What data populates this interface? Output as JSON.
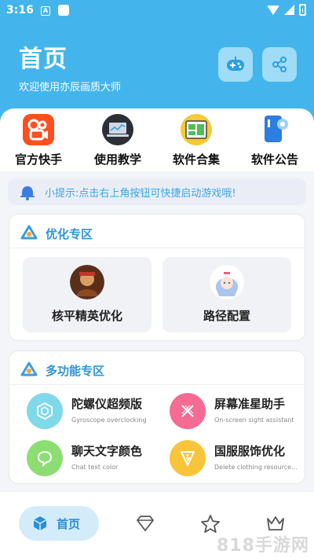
{
  "status_bar": {
    "time": "3:16",
    "notif_icon": "A"
  },
  "header": {
    "title": "首页",
    "subtitle": "欢迎使用亦辰画质大师",
    "buttons": [
      {
        "icon": "gamepad-icon"
      },
      {
        "icon": "share-icon"
      }
    ]
  },
  "quick_nav": [
    {
      "label": "官方快手",
      "icon": "kuaishou-logo-icon"
    },
    {
      "label": "使用教学",
      "icon": "laptop-icon"
    },
    {
      "label": "软件合集",
      "icon": "app-collection-icon"
    },
    {
      "label": "软件公告",
      "icon": "announcement-icon"
    }
  ],
  "tip": {
    "text": "小提示:点击右上角按钮可快捷启动游戏哦!",
    "icon": "bell-icon"
  },
  "optimize_section": {
    "title": "优化专区",
    "items": [
      {
        "label": "核平精英优化",
        "icon": "game-character-avatar"
      },
      {
        "label": "路径配置",
        "icon": "anime-girl-avatar"
      }
    ]
  },
  "multi_section": {
    "title": "多功能专区",
    "items": [
      {
        "title": "陀螺仪超频版",
        "subtitle": "Gyroscope overclocking",
        "color": "#7fd9e8",
        "icon": "hexagon-icon"
      },
      {
        "title": "屏幕准星助手",
        "subtitle": "On-screen sight assistant",
        "color": "#f56b93",
        "icon": "crosshair-x-icon"
      },
      {
        "title": "聊天文字颜色",
        "subtitle": "Chat text color",
        "color": "#8cde73",
        "icon": "chat-bubble-icon"
      },
      {
        "title": "国服服饰优化",
        "subtitle": "Delete clothing resource...",
        "color": "#f8c53a",
        "icon": "shield-icon"
      }
    ]
  },
  "bottom_nav": {
    "items": [
      {
        "label": "首页",
        "icon": "home-cube-icon",
        "active": true
      },
      {
        "label": "",
        "icon": "diamond-icon"
      },
      {
        "label": "",
        "icon": "star-icon"
      },
      {
        "label": "",
        "icon": "crown-icon"
      }
    ]
  },
  "watermark": "818手游网",
  "colors": {
    "primary": "#43b5ec",
    "accent_text": "#2e95d6",
    "tip_text": "#3aa6e6"
  }
}
